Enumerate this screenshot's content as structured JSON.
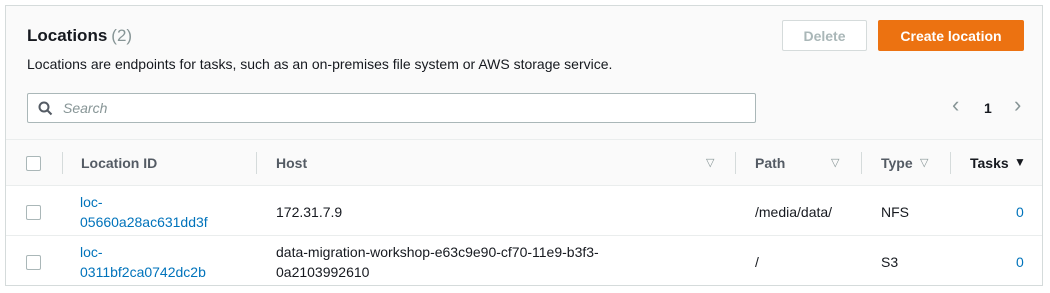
{
  "panel": {
    "title": "Locations",
    "count": "(2)",
    "description": "Locations are endpoints for tasks, such as an on-premises file system or AWS storage service.",
    "delete_label": "Delete",
    "create_label": "Create location",
    "search_placeholder": "Search",
    "page_prev": "‹",
    "page_number": "1",
    "page_next": "›",
    "colors": {
      "accent": "#ec7211",
      "link": "#0073bb"
    }
  },
  "table": {
    "headers": {
      "location_id": "Location ID",
      "host": "Host",
      "path": "Path",
      "type": "Type",
      "tasks": "Tasks"
    },
    "sort_icons": {
      "host": "▽",
      "path": "▽",
      "type": "▽",
      "tasks": "▼"
    },
    "rows": [
      {
        "id_line1": "loc-",
        "id_line2": "05660a28ac631dd3f",
        "host_line1": "172.31.7.9",
        "host_line2": "",
        "path": "/media/data/",
        "type": "NFS",
        "tasks": "0"
      },
      {
        "id_line1": "loc-",
        "id_line2": "0311bf2ca0742dc2b",
        "host_line1": "data-migration-workshop-e63c9e90-cf70-11e9-b3f3-",
        "host_line2": "0a2103992610",
        "path": "/",
        "type": "S3",
        "tasks": "0"
      }
    ]
  }
}
